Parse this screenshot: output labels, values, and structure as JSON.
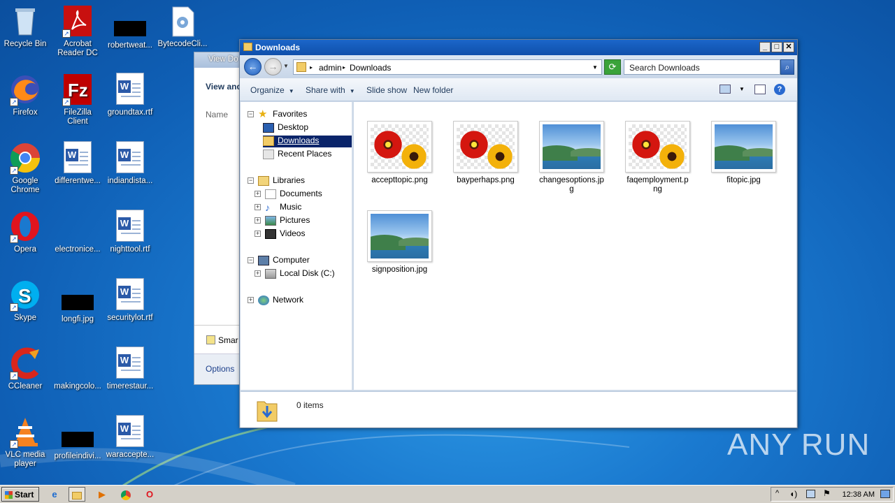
{
  "desktop": {
    "icons": [
      {
        "label": "Recycle Bin",
        "icon": "recycle-bin-icon"
      },
      {
        "label": "Acrobat Reader DC",
        "icon": "acrobat-icon"
      },
      {
        "label": "robertweat...",
        "icon": "file-icon"
      },
      {
        "label": "BytecodeCli...",
        "icon": "app-icon"
      },
      {
        "label": "Firefox",
        "icon": "firefox-icon"
      },
      {
        "label": "FileZilla Client",
        "icon": "filezilla-icon"
      },
      {
        "label": "groundtax.rtf",
        "icon": "word-doc-icon"
      },
      {
        "label": "Google Chrome",
        "icon": "chrome-icon"
      },
      {
        "label": "differentwe...",
        "icon": "word-doc-icon"
      },
      {
        "label": "indiandista...",
        "icon": "word-doc-icon"
      },
      {
        "label": "Opera",
        "icon": "opera-icon"
      },
      {
        "label": "electronice...",
        "icon": "file-icon"
      },
      {
        "label": "nighttool.rtf",
        "icon": "word-doc-icon"
      },
      {
        "label": "Skype",
        "icon": "skype-icon"
      },
      {
        "label": "longfi.jpg",
        "icon": "image-icon"
      },
      {
        "label": "securitylot.rtf",
        "icon": "word-doc-icon"
      },
      {
        "label": "CCleaner",
        "icon": "ccleaner-icon"
      },
      {
        "label": "makingcolo...",
        "icon": "file-icon"
      },
      {
        "label": "timerestaur...",
        "icon": "word-doc-icon"
      },
      {
        "label": "VLC media player",
        "icon": "vlc-icon"
      },
      {
        "label": "profileindivi...",
        "icon": "image-icon"
      },
      {
        "label": "waraccepte...",
        "icon": "word-doc-icon"
      }
    ]
  },
  "background_window": {
    "title": "View Do",
    "heading": "View and",
    "column": "Name",
    "smart": "Smar",
    "options": "Options"
  },
  "explorer": {
    "title": "Downloads",
    "breadcrumb": [
      "admin",
      "Downloads"
    ],
    "search_placeholder": "Search Downloads",
    "commands": {
      "organize": "Organize",
      "share": "Share with",
      "slideshow": "Slide show",
      "new_folder": "New folder"
    },
    "tree": {
      "favorites": "Favorites",
      "desktop": "Desktop",
      "downloads": "Downloads",
      "recent": "Recent Places",
      "libraries": "Libraries",
      "documents": "Documents",
      "music": "Music",
      "pictures": "Pictures",
      "videos": "Videos",
      "computer": "Computer",
      "local_disk": "Local Disk (C:)",
      "network": "Network"
    },
    "files": [
      {
        "name": "accepttopic.png",
        "thumb": "flower"
      },
      {
        "name": "bayperhaps.png",
        "thumb": "flower"
      },
      {
        "name": "changesoptions.jpg",
        "thumb": "sea"
      },
      {
        "name": "faqemployment.png",
        "thumb": "flower"
      },
      {
        "name": "fitopic.jpg",
        "thumb": "sea"
      },
      {
        "name": "signposition.jpg",
        "thumb": "sea"
      }
    ],
    "status": "0 items"
  },
  "taskbar": {
    "start": "Start",
    "clock": "12:38 AM"
  },
  "watermark": "ANY RUN"
}
